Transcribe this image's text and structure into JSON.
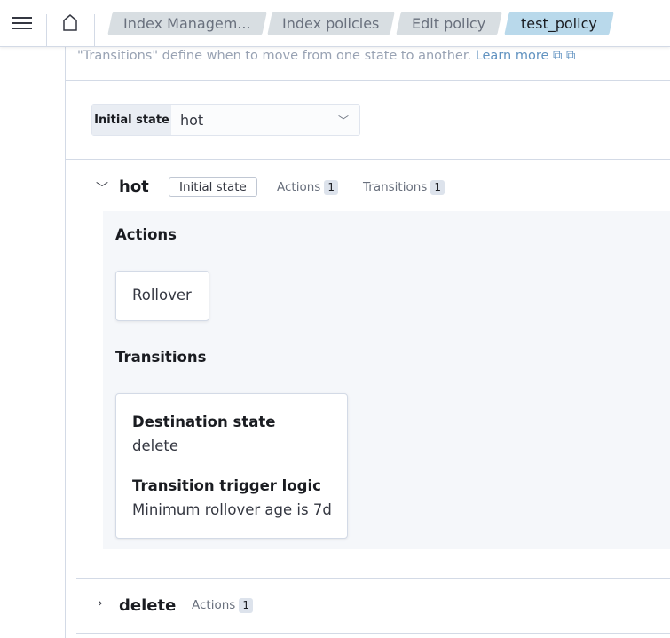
{
  "breadcrumbs": [
    "Index Managem...",
    "Index policies",
    "Edit policy",
    "test_policy"
  ],
  "description": "\"Transitions\" define when to move from one state to another.",
  "learn_more": "Learn more",
  "initial_state": {
    "label": "Initial state",
    "value": "hot"
  },
  "states": [
    {
      "name": "hot",
      "badge": "Initial state",
      "actions_label": "Actions",
      "actions_count": "1",
      "transitions_label": "Transitions",
      "transitions_count": "1",
      "actions_heading": "Actions",
      "action": "Rollover",
      "transitions_heading": "Transitions",
      "dest_label": "Destination state",
      "dest_value": "delete",
      "trigger_label": "Transition trigger logic",
      "trigger_value": "Minimum rollover age is 7d"
    },
    {
      "name": "delete",
      "actions_label": "Actions",
      "actions_count": "1"
    }
  ]
}
